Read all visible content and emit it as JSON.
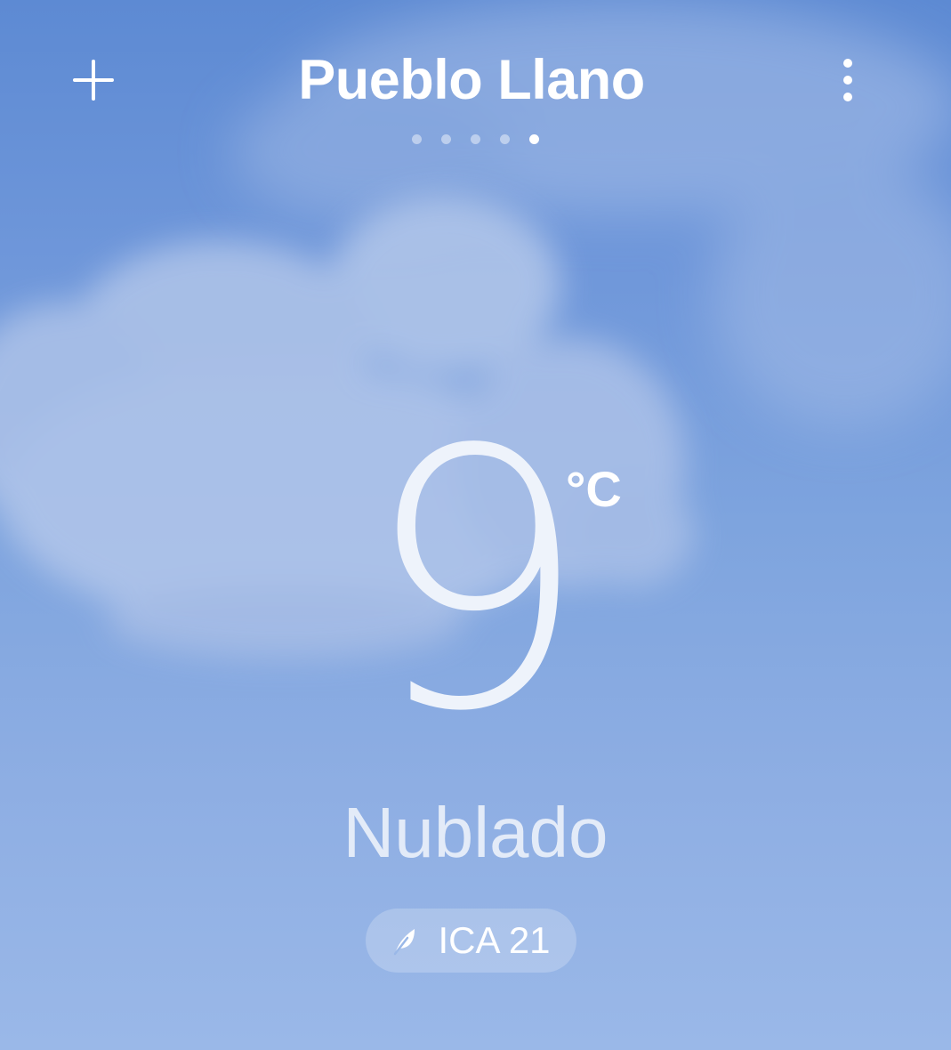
{
  "header": {
    "city": "Pueblo Llano",
    "add_icon": "plus-icon",
    "menu_icon": "more-vertical-icon",
    "pages_total": 5,
    "active_page": 5
  },
  "current": {
    "temperature": "9",
    "unit": "°C",
    "condition": "Nublado"
  },
  "air_quality": {
    "icon": "leaf-icon",
    "label": "ICA 21"
  },
  "colors": {
    "sky_top": "#5d8ad3",
    "sky_bottom": "#9ab8e8",
    "text": "#ffffff"
  }
}
